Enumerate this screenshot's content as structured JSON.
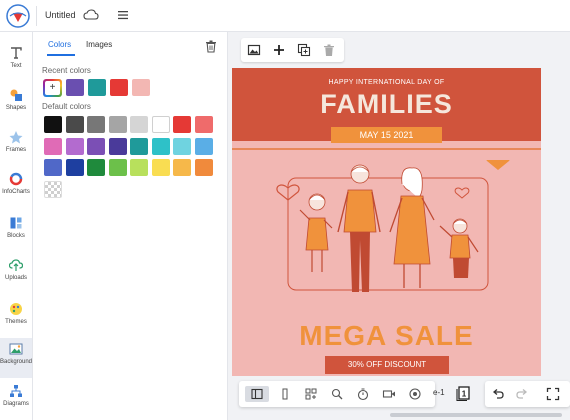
{
  "header": {
    "doc_title": "Untitled"
  },
  "rail": {
    "items": [
      {
        "label": "Text",
        "icon": "text-icon"
      },
      {
        "label": "Shapes",
        "icon": "shapes-icon"
      },
      {
        "label": "Frames",
        "icon": "frames-icon"
      },
      {
        "label": "InfoCharts",
        "icon": "infocharts-icon"
      },
      {
        "label": "Blocks",
        "icon": "blocks-icon"
      },
      {
        "label": "Uploads",
        "icon": "uploads-icon"
      },
      {
        "label": "Themes",
        "icon": "themes-icon"
      },
      {
        "label": "Background",
        "icon": "background-icon",
        "active": true
      },
      {
        "label": "Diagrams",
        "icon": "diagrams-icon"
      }
    ]
  },
  "panel": {
    "tabs": [
      "Colors",
      "Images"
    ],
    "active_tab": "Colors",
    "recent_label": "Recent colors",
    "default_label": "Default colors",
    "add_color_symbol": "+",
    "recent_colors": [
      "#6a4fb0",
      "#1f9a9a",
      "#e53935",
      "#f3b7b3"
    ],
    "default_colors": [
      [
        "#111111",
        "#4a4a4a",
        "#777777",
        "#a5a5a5",
        "#d5d5d5",
        "#ffffff",
        "#e53935",
        "#ef6b6b"
      ],
      [
        "#e06bb6",
        "#b36bcf",
        "#7b4fb5",
        "#4a3a9a",
        "#1f9a9a",
        "#2ec1c8",
        "#6fd3e0",
        "#5aaee6"
      ],
      [
        "#5068c8",
        "#1e3fa0",
        "#1f8a3c",
        "#6cc04a",
        "#b8e05c",
        "#f9dd52",
        "#f6b84a",
        "#f08a3c"
      ],
      [
        "transparent"
      ]
    ]
  },
  "design": {
    "top_line": "HAPPY INTERNATIONAL DAY OF",
    "title": "FAMILIES",
    "date": "MAY 15 2021",
    "headline": "MEGA SALE",
    "subline": "30% OFF DISCOUNT",
    "colors": {
      "header": "#d0543c",
      "background": "#f2b7b3",
      "accent": "#f0923c",
      "title": "#f5e7dc"
    }
  },
  "bottom": {
    "page_indicator": "e-1",
    "page_count": "1"
  }
}
